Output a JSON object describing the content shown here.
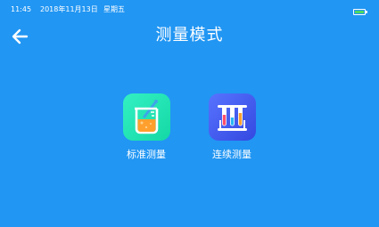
{
  "status_bar": {
    "time": "11:45",
    "date": "2018年11月13日",
    "weekday": "星期五",
    "battery_level": 1.0,
    "battery_color": "#4cd964"
  },
  "header": {
    "back_icon": "arrow-left-icon",
    "title": "测量模式"
  },
  "modes": [
    {
      "label": "标准测量",
      "icon": "beaker-icon",
      "icon_color": "#1de9b6"
    },
    {
      "label": "连续测量",
      "icon": "test-tubes-icon",
      "icon_color": "#3d5afe"
    }
  ],
  "colors": {
    "background": "#2196f3",
    "text": "#ffffff"
  }
}
